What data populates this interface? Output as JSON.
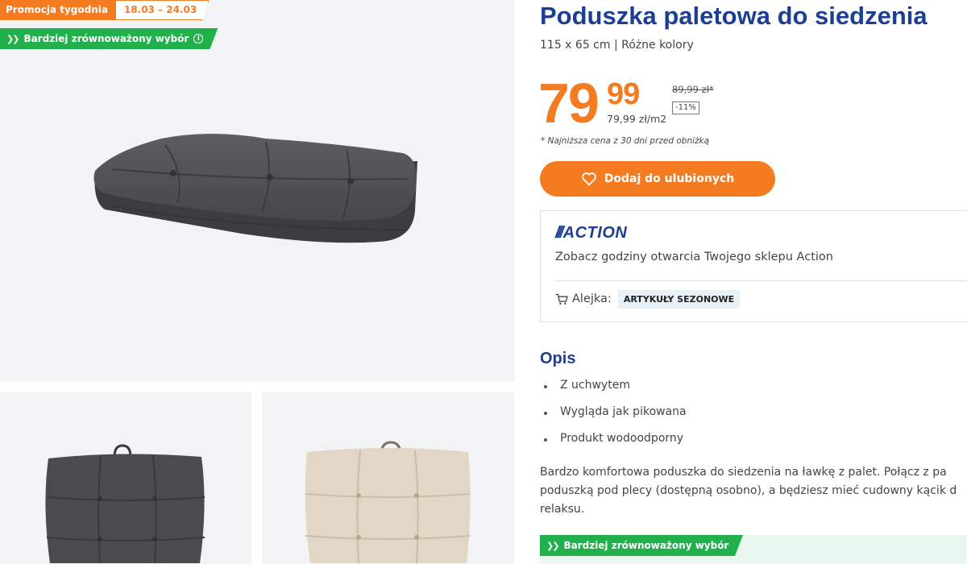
{
  "promo": {
    "label": "Promocja tygodnia",
    "dates": "18.03 – 24.03"
  },
  "sustainable_badge": {
    "label": "Bardziej zrównoważony wybór",
    "icon": "chevrons-right-icon",
    "info_icon": "info-icon",
    "color": "#21b04b"
  },
  "product": {
    "title": "Poduszka paletowa do siedzenia",
    "subtitle": "115 x 65 cm | Różne kolory",
    "price_whole": "79",
    "price_cents": "99",
    "unit_price": "79,99 zł/m2",
    "old_price": "89,99 zł",
    "old_price_marker": "*",
    "discount": "-11%",
    "lowest_price_note": "* Najniższa cena z 30 dni przed obniżką",
    "favorite_button": "Dodaj do ulubionych",
    "favorite_icon": "heart-icon"
  },
  "store": {
    "logo_text": "ACTION",
    "logo_slashes": "///",
    "hours_link": "Zobacz godziny otwarcia Twojego sklepu Action",
    "aisle_label": "Alejka:",
    "aisle_icon": "cart-icon",
    "aisle_value": "ARTYKUŁY SEZONOWE"
  },
  "description": {
    "title": "Opis",
    "bullets": [
      "Z uchwytem",
      "Wygląda jak pikowana",
      "Produkt wodoodporny"
    ],
    "text_lines": [
      "Bardzo komfortowa poduszka do siedzenia na ławkę z palet. Połącz z pa",
      "poduszką pod plecy (dostępną osobno), a będziesz mieć cudowny kącik d",
      "relaksu."
    ]
  },
  "gallery": {
    "main_alt": "dark-grey-cushion",
    "thumbs": [
      "dark-grey-cushion",
      "beige-cushion"
    ]
  },
  "colors": {
    "brand_blue": "#1c3f94",
    "accent_orange": "#f47b20",
    "gallery_bg": "#f2f3f5",
    "cushion_dark": "#4e4f52",
    "cushion_beige": "#e2d6c5"
  }
}
